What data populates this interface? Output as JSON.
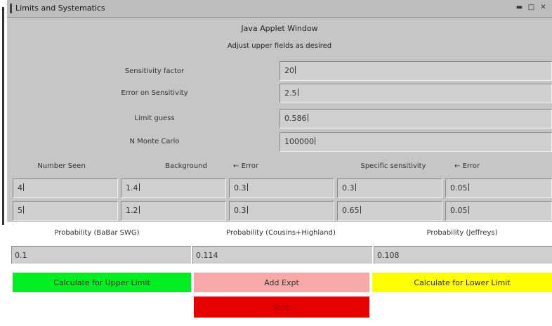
{
  "window": {
    "title": "Limits and Systematics",
    "buttons": [
      "minimize-icon",
      "maximize-icon",
      "close-icon"
    ]
  },
  "header": {
    "title": "Java Applet Window",
    "subtitle": "Adjust upper fields as desired"
  },
  "settings": [
    {
      "label": "Sensitivity factor",
      "value": "20"
    },
    {
      "label": "Error on Sensitivity",
      "value": "2.5"
    },
    {
      "label": "Limit guess",
      "value": "0.586"
    },
    {
      "label": "N Monte Carlo",
      "value": "100000"
    }
  ],
  "columns": [
    "Number Seen",
    "Background",
    "← Error",
    "Specific sensitivity",
    "← Error"
  ],
  "rows": [
    [
      "4",
      "1.4",
      "0.3",
      "0.3",
      "0.05"
    ],
    [
      "5",
      "1.2",
      "0.3",
      "0.65",
      "0.05"
    ]
  ],
  "probabilities": [
    {
      "label": "Probability  (BaBar SWG)",
      "value": "0.1"
    },
    {
      "label": "Probability  (Cousins+Highland)",
      "value": "0.114"
    },
    {
      "label": "Probability  (Jeffreys)",
      "value": "0.108"
    }
  ],
  "actions": {
    "upper": "Calculate for Upper Limit",
    "add": "Add Expt",
    "lower": "Calculate for Lower Limit",
    "stop": "Stop"
  },
  "colors": {
    "upper": "#00ee22",
    "add": "#f7a9a9",
    "lower": "#ffff00",
    "stop": "#e60000"
  }
}
